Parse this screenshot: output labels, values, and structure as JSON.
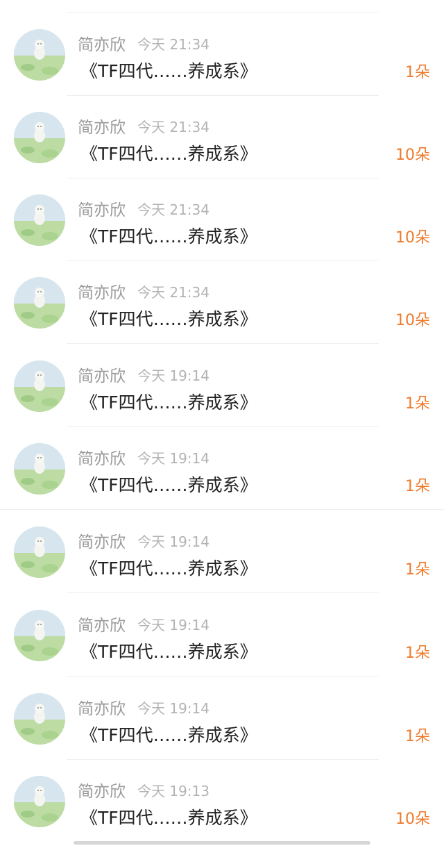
{
  "gift_records": [
    {
      "name": "简亦欣",
      "time": "今天 21:34",
      "gift": "《TF四代……养成系》",
      "count": "1朵"
    },
    {
      "name": "简亦欣",
      "time": "今天 21:34",
      "gift": "《TF四代……养成系》",
      "count": "10朵"
    },
    {
      "name": "简亦欣",
      "time": "今天 21:34",
      "gift": "《TF四代……养成系》",
      "count": "10朵"
    },
    {
      "name": "简亦欣",
      "time": "今天 21:34",
      "gift": "《TF四代……养成系》",
      "count": "10朵"
    },
    {
      "name": "简亦欣",
      "time": "今天 19:14",
      "gift": "《TF四代……养成系》",
      "count": "1朵"
    },
    {
      "name": "简亦欣",
      "time": "今天 19:14",
      "gift": "《TF四代……养成系》",
      "count": "1朵"
    },
    {
      "name": "简亦欣",
      "time": "今天 19:14",
      "gift": "《TF四代……养成系》",
      "count": "1朵"
    },
    {
      "name": "简亦欣",
      "time": "今天 19:14",
      "gift": "《TF四代……养成系》",
      "count": "1朵"
    },
    {
      "name": "简亦欣",
      "time": "今天 19:14",
      "gift": "《TF四代……养成系》",
      "count": "1朵"
    },
    {
      "name": "简亦欣",
      "time": "今天 19:13",
      "gift": "《TF四代……养成系》",
      "count": "10朵"
    }
  ],
  "avatar_icon": "user-avatar-icon",
  "colors": {
    "count_accent": "#ef7a2b",
    "name_text": "#9a9a9a",
    "time_text": "#b3b3b3",
    "gift_text": "#222222"
  }
}
